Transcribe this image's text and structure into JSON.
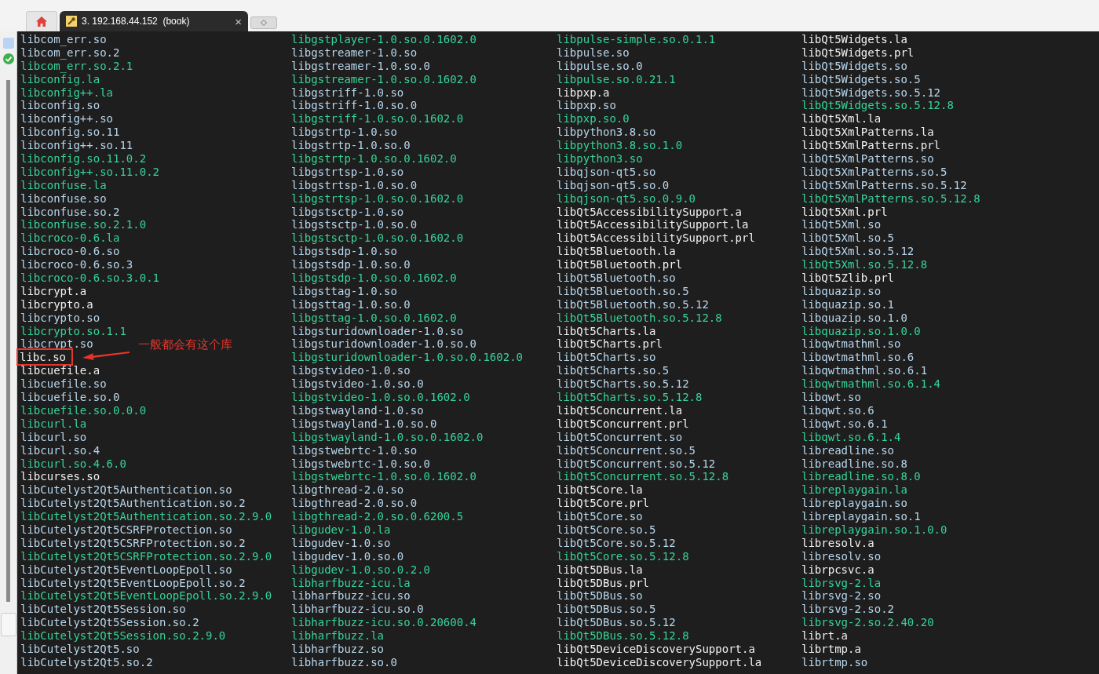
{
  "tabs": [
    {
      "kind": "home",
      "selected": false
    },
    {
      "kind": "session",
      "label": "3. 192.168.44.152  (book)",
      "close": "×",
      "selected": true
    },
    {
      "kind": "new",
      "selected": false
    }
  ],
  "columns": [
    {
      "entries": [
        {
          "name": "libcom_err.so",
          "kind": "link"
        },
        {
          "name": "libcom_err.so.2",
          "kind": "link"
        },
        {
          "name": "libcom_err.so.2.1",
          "kind": "exec"
        },
        {
          "name": "libconfig.la",
          "kind": "exec"
        },
        {
          "name": "libconfig++.la",
          "kind": "exec"
        },
        {
          "name": "libconfig.so",
          "kind": "link"
        },
        {
          "name": "libconfig++.so",
          "kind": "link"
        },
        {
          "name": "libconfig.so.11",
          "kind": "link"
        },
        {
          "name": "libconfig++.so.11",
          "kind": "link"
        },
        {
          "name": "libconfig.so.11.0.2",
          "kind": "exec"
        },
        {
          "name": "libconfig++.so.11.0.2",
          "kind": "exec"
        },
        {
          "name": "libconfuse.la",
          "kind": "exec"
        },
        {
          "name": "libconfuse.so",
          "kind": "link"
        },
        {
          "name": "libconfuse.so.2",
          "kind": "link"
        },
        {
          "name": "libconfuse.so.2.1.0",
          "kind": "exec"
        },
        {
          "name": "libcroco-0.6.la",
          "kind": "exec"
        },
        {
          "name": "libcroco-0.6.so",
          "kind": "link"
        },
        {
          "name": "libcroco-0.6.so.3",
          "kind": "link"
        },
        {
          "name": "libcroco-0.6.so.3.0.1",
          "kind": "exec"
        },
        {
          "name": "libcrypt.a",
          "kind": "file"
        },
        {
          "name": "libcrypto.a",
          "kind": "file"
        },
        {
          "name": "libcrypto.so",
          "kind": "link"
        },
        {
          "name": "libcrypto.so.1.1",
          "kind": "exec"
        },
        {
          "name": "libcrypt.so",
          "kind": "link"
        },
        {
          "name": "libc.so",
          "kind": "file",
          "highlighted": true
        },
        {
          "name": "libcuefile.a",
          "kind": "file"
        },
        {
          "name": "libcuefile.so",
          "kind": "link"
        },
        {
          "name": "libcuefile.so.0",
          "kind": "link"
        },
        {
          "name": "libcuefile.so.0.0.0",
          "kind": "exec"
        },
        {
          "name": "libcurl.la",
          "kind": "exec"
        },
        {
          "name": "libcurl.so",
          "kind": "link"
        },
        {
          "name": "libcurl.so.4",
          "kind": "link"
        },
        {
          "name": "libcurl.so.4.6.0",
          "kind": "exec"
        },
        {
          "name": "libcurses.so",
          "kind": "file"
        },
        {
          "name": "libCutelyst2Qt5Authentication.so",
          "kind": "link"
        },
        {
          "name": "libCutelyst2Qt5Authentication.so.2",
          "kind": "link"
        },
        {
          "name": "libCutelyst2Qt5Authentication.so.2.9.0",
          "kind": "exec"
        },
        {
          "name": "libCutelyst2Qt5CSRFProtection.so",
          "kind": "link"
        },
        {
          "name": "libCutelyst2Qt5CSRFProtection.so.2",
          "kind": "link"
        },
        {
          "name": "libCutelyst2Qt5CSRFProtection.so.2.9.0",
          "kind": "exec"
        },
        {
          "name": "libCutelyst2Qt5EventLoopEpoll.so",
          "kind": "link"
        },
        {
          "name": "libCutelyst2Qt5EventLoopEpoll.so.2",
          "kind": "link"
        },
        {
          "name": "libCutelyst2Qt5EventLoopEpoll.so.2.9.0",
          "kind": "exec"
        },
        {
          "name": "libCutelyst2Qt5Session.so",
          "kind": "link"
        },
        {
          "name": "libCutelyst2Qt5Session.so.2",
          "kind": "link"
        },
        {
          "name": "libCutelyst2Qt5Session.so.2.9.0",
          "kind": "exec"
        },
        {
          "name": "libCutelyst2Qt5.so",
          "kind": "link"
        },
        {
          "name": "libCutelyst2Qt5.so.2",
          "kind": "link"
        }
      ]
    },
    {
      "entries": [
        {
          "name": "libgstplayer-1.0.so.0.1602.0",
          "kind": "exec"
        },
        {
          "name": "libgstreamer-1.0.so",
          "kind": "link"
        },
        {
          "name": "libgstreamer-1.0.so.0",
          "kind": "link"
        },
        {
          "name": "libgstreamer-1.0.so.0.1602.0",
          "kind": "exec"
        },
        {
          "name": "libgstriff-1.0.so",
          "kind": "link"
        },
        {
          "name": "libgstriff-1.0.so.0",
          "kind": "link"
        },
        {
          "name": "libgstriff-1.0.so.0.1602.0",
          "kind": "exec"
        },
        {
          "name": "libgstrtp-1.0.so",
          "kind": "link"
        },
        {
          "name": "libgstrtp-1.0.so.0",
          "kind": "link"
        },
        {
          "name": "libgstrtp-1.0.so.0.1602.0",
          "kind": "exec"
        },
        {
          "name": "libgstrtsp-1.0.so",
          "kind": "link"
        },
        {
          "name": "libgstrtsp-1.0.so.0",
          "kind": "link"
        },
        {
          "name": "libgstrtsp-1.0.so.0.1602.0",
          "kind": "exec"
        },
        {
          "name": "libgstsctp-1.0.so",
          "kind": "link"
        },
        {
          "name": "libgstsctp-1.0.so.0",
          "kind": "link"
        },
        {
          "name": "libgstsctp-1.0.so.0.1602.0",
          "kind": "exec"
        },
        {
          "name": "libgstsdp-1.0.so",
          "kind": "link"
        },
        {
          "name": "libgstsdp-1.0.so.0",
          "kind": "link"
        },
        {
          "name": "libgstsdp-1.0.so.0.1602.0",
          "kind": "exec"
        },
        {
          "name": "libgsttag-1.0.so",
          "kind": "link"
        },
        {
          "name": "libgsttag-1.0.so.0",
          "kind": "link"
        },
        {
          "name": "libgsttag-1.0.so.0.1602.0",
          "kind": "exec"
        },
        {
          "name": "libgsturidownloader-1.0.so",
          "kind": "link"
        },
        {
          "name": "libgsturidownloader-1.0.so.0",
          "kind": "link"
        },
        {
          "name": "libgsturidownloader-1.0.so.0.1602.0",
          "kind": "exec"
        },
        {
          "name": "libgstvideo-1.0.so",
          "kind": "link"
        },
        {
          "name": "libgstvideo-1.0.so.0",
          "kind": "link"
        },
        {
          "name": "libgstvideo-1.0.so.0.1602.0",
          "kind": "exec"
        },
        {
          "name": "libgstwayland-1.0.so",
          "kind": "link"
        },
        {
          "name": "libgstwayland-1.0.so.0",
          "kind": "link"
        },
        {
          "name": "libgstwayland-1.0.so.0.1602.0",
          "kind": "exec"
        },
        {
          "name": "libgstwebrtc-1.0.so",
          "kind": "link"
        },
        {
          "name": "libgstwebrtc-1.0.so.0",
          "kind": "link"
        },
        {
          "name": "libgstwebrtc-1.0.so.0.1602.0",
          "kind": "exec"
        },
        {
          "name": "libgthread-2.0.so",
          "kind": "link"
        },
        {
          "name": "libgthread-2.0.so.0",
          "kind": "link"
        },
        {
          "name": "libgthread-2.0.so.0.6200.5",
          "kind": "exec"
        },
        {
          "name": "libgudev-1.0.la",
          "kind": "exec"
        },
        {
          "name": "libgudev-1.0.so",
          "kind": "link"
        },
        {
          "name": "libgudev-1.0.so.0",
          "kind": "link"
        },
        {
          "name": "libgudev-1.0.so.0.2.0",
          "kind": "exec"
        },
        {
          "name": "libharfbuzz-icu.la",
          "kind": "exec"
        },
        {
          "name": "libharfbuzz-icu.so",
          "kind": "link"
        },
        {
          "name": "libharfbuzz-icu.so.0",
          "kind": "link"
        },
        {
          "name": "libharfbuzz-icu.so.0.20600.4",
          "kind": "exec"
        },
        {
          "name": "libharfbuzz.la",
          "kind": "exec"
        },
        {
          "name": "libharfbuzz.so",
          "kind": "link"
        },
        {
          "name": "libharfbuzz.so.0",
          "kind": "link"
        }
      ]
    },
    {
      "entries": [
        {
          "name": "libpulse-simple.so.0.1.1",
          "kind": "exec"
        },
        {
          "name": "libpulse.so",
          "kind": "link"
        },
        {
          "name": "libpulse.so.0",
          "kind": "link"
        },
        {
          "name": "libpulse.so.0.21.1",
          "kind": "exec"
        },
        {
          "name": "libpxp.a",
          "kind": "file"
        },
        {
          "name": "libpxp.so",
          "kind": "link"
        },
        {
          "name": "libpxp.so.0",
          "kind": "exec"
        },
        {
          "name": "libpython3.8.so",
          "kind": "link"
        },
        {
          "name": "libpython3.8.so.1.0",
          "kind": "exec"
        },
        {
          "name": "libpython3.so",
          "kind": "exec"
        },
        {
          "name": "libqjson-qt5.so",
          "kind": "link"
        },
        {
          "name": "libqjson-qt5.so.0",
          "kind": "link"
        },
        {
          "name": "libqjson-qt5.so.0.9.0",
          "kind": "exec"
        },
        {
          "name": "libQt5AccessibilitySupport.a",
          "kind": "file"
        },
        {
          "name": "libQt5AccessibilitySupport.la",
          "kind": "file"
        },
        {
          "name": "libQt5AccessibilitySupport.prl",
          "kind": "file"
        },
        {
          "name": "libQt5Bluetooth.la",
          "kind": "file"
        },
        {
          "name": "libQt5Bluetooth.prl",
          "kind": "file"
        },
        {
          "name": "libQt5Bluetooth.so",
          "kind": "link"
        },
        {
          "name": "libQt5Bluetooth.so.5",
          "kind": "link"
        },
        {
          "name": "libQt5Bluetooth.so.5.12",
          "kind": "link"
        },
        {
          "name": "libQt5Bluetooth.so.5.12.8",
          "kind": "exec"
        },
        {
          "name": "libQt5Charts.la",
          "kind": "file"
        },
        {
          "name": "libQt5Charts.prl",
          "kind": "file"
        },
        {
          "name": "libQt5Charts.so",
          "kind": "link"
        },
        {
          "name": "libQt5Charts.so.5",
          "kind": "link"
        },
        {
          "name": "libQt5Charts.so.5.12",
          "kind": "link"
        },
        {
          "name": "libQt5Charts.so.5.12.8",
          "kind": "exec"
        },
        {
          "name": "libQt5Concurrent.la",
          "kind": "file"
        },
        {
          "name": "libQt5Concurrent.prl",
          "kind": "file"
        },
        {
          "name": "libQt5Concurrent.so",
          "kind": "link"
        },
        {
          "name": "libQt5Concurrent.so.5",
          "kind": "link"
        },
        {
          "name": "libQt5Concurrent.so.5.12",
          "kind": "link"
        },
        {
          "name": "libQt5Concurrent.so.5.12.8",
          "kind": "exec"
        },
        {
          "name": "libQt5Core.la",
          "kind": "file"
        },
        {
          "name": "libQt5Core.prl",
          "kind": "file"
        },
        {
          "name": "libQt5Core.so",
          "kind": "link"
        },
        {
          "name": "libQt5Core.so.5",
          "kind": "link"
        },
        {
          "name": "libQt5Core.so.5.12",
          "kind": "link"
        },
        {
          "name": "libQt5Core.so.5.12.8",
          "kind": "exec"
        },
        {
          "name": "libQt5DBus.la",
          "kind": "file"
        },
        {
          "name": "libQt5DBus.prl",
          "kind": "file"
        },
        {
          "name": "libQt5DBus.so",
          "kind": "link"
        },
        {
          "name": "libQt5DBus.so.5",
          "kind": "link"
        },
        {
          "name": "libQt5DBus.so.5.12",
          "kind": "link"
        },
        {
          "name": "libQt5DBus.so.5.12.8",
          "kind": "exec"
        },
        {
          "name": "libQt5DeviceDiscoverySupport.a",
          "kind": "file"
        },
        {
          "name": "libQt5DeviceDiscoverySupport.la",
          "kind": "file"
        }
      ]
    },
    {
      "entries": [
        {
          "name": "libQt5Widgets.la",
          "kind": "file"
        },
        {
          "name": "libQt5Widgets.prl",
          "kind": "file"
        },
        {
          "name": "libQt5Widgets.so",
          "kind": "link"
        },
        {
          "name": "libQt5Widgets.so.5",
          "kind": "link"
        },
        {
          "name": "libQt5Widgets.so.5.12",
          "kind": "link"
        },
        {
          "name": "libQt5Widgets.so.5.12.8",
          "kind": "exec"
        },
        {
          "name": "libQt5Xml.la",
          "kind": "file"
        },
        {
          "name": "libQt5XmlPatterns.la",
          "kind": "file"
        },
        {
          "name": "libQt5XmlPatterns.prl",
          "kind": "file"
        },
        {
          "name": "libQt5XmlPatterns.so",
          "kind": "link"
        },
        {
          "name": "libQt5XmlPatterns.so.5",
          "kind": "link"
        },
        {
          "name": "libQt5XmlPatterns.so.5.12",
          "kind": "link"
        },
        {
          "name": "libQt5XmlPatterns.so.5.12.8",
          "kind": "exec"
        },
        {
          "name": "libQt5Xml.prl",
          "kind": "file"
        },
        {
          "name": "libQt5Xml.so",
          "kind": "link"
        },
        {
          "name": "libQt5Xml.so.5",
          "kind": "link"
        },
        {
          "name": "libQt5Xml.so.5.12",
          "kind": "link"
        },
        {
          "name": "libQt5Xml.so.5.12.8",
          "kind": "exec"
        },
        {
          "name": "libQt5Zlib.prl",
          "kind": "file"
        },
        {
          "name": "libquazip.so",
          "kind": "link"
        },
        {
          "name": "libquazip.so.1",
          "kind": "link"
        },
        {
          "name": "libquazip.so.1.0",
          "kind": "link"
        },
        {
          "name": "libquazip.so.1.0.0",
          "kind": "exec"
        },
        {
          "name": "libqwtmathml.so",
          "kind": "link"
        },
        {
          "name": "libqwtmathml.so.6",
          "kind": "link"
        },
        {
          "name": "libqwtmathml.so.6.1",
          "kind": "link"
        },
        {
          "name": "libqwtmathml.so.6.1.4",
          "kind": "exec"
        },
        {
          "name": "libqwt.so",
          "kind": "link"
        },
        {
          "name": "libqwt.so.6",
          "kind": "link"
        },
        {
          "name": "libqwt.so.6.1",
          "kind": "link"
        },
        {
          "name": "libqwt.so.6.1.4",
          "kind": "exec"
        },
        {
          "name": "libreadline.so",
          "kind": "link"
        },
        {
          "name": "libreadline.so.8",
          "kind": "link"
        },
        {
          "name": "libreadline.so.8.0",
          "kind": "exec"
        },
        {
          "name": "libreplaygain.la",
          "kind": "exec"
        },
        {
          "name": "libreplaygain.so",
          "kind": "link"
        },
        {
          "name": "libreplaygain.so.1",
          "kind": "link"
        },
        {
          "name": "libreplaygain.so.1.0.0",
          "kind": "exec"
        },
        {
          "name": "libresolv.a",
          "kind": "file"
        },
        {
          "name": "libresolv.so",
          "kind": "link"
        },
        {
          "name": "librpcsvc.a",
          "kind": "file"
        },
        {
          "name": "librsvg-2.la",
          "kind": "exec"
        },
        {
          "name": "librsvg-2.so",
          "kind": "link"
        },
        {
          "name": "librsvg-2.so.2",
          "kind": "link"
        },
        {
          "name": "librsvg-2.so.2.40.20",
          "kind": "exec"
        },
        {
          "name": "librt.a",
          "kind": "file"
        },
        {
          "name": "librtmp.a",
          "kind": "file"
        },
        {
          "name": "librtmp.so",
          "kind": "link"
        }
      ]
    }
  ],
  "annotation": {
    "text": "一般都会有这个库"
  }
}
